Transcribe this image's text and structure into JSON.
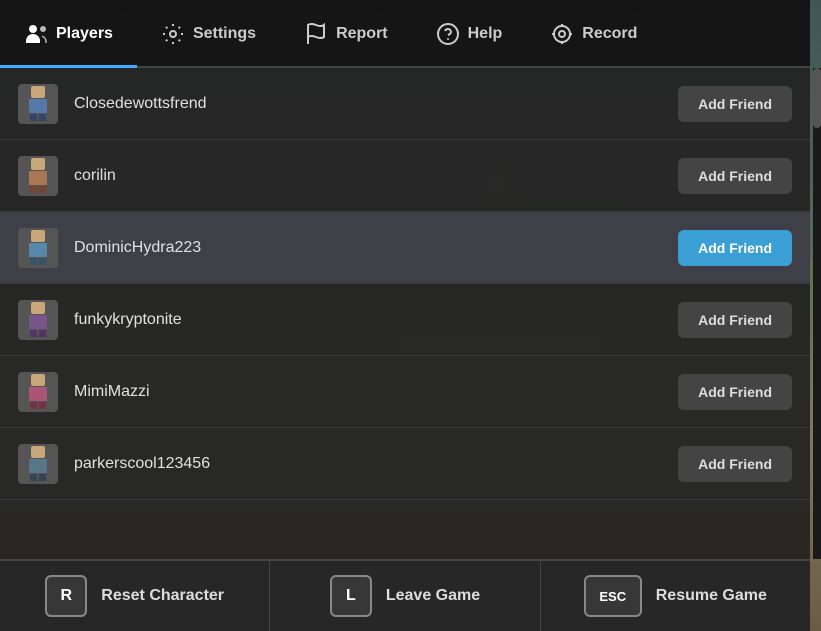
{
  "tabs": [
    {
      "id": "players",
      "label": "Players",
      "active": true,
      "icon": "players"
    },
    {
      "id": "settings",
      "label": "Settings",
      "active": false,
      "icon": "settings"
    },
    {
      "id": "report",
      "label": "Report",
      "active": false,
      "icon": "flag"
    },
    {
      "id": "help",
      "label": "Help",
      "active": false,
      "icon": "help"
    },
    {
      "id": "record",
      "label": "Record",
      "active": false,
      "icon": "record"
    }
  ],
  "players": [
    {
      "id": 1,
      "name": "Closedewottsfrend",
      "avatar_color": "#5577aa",
      "add_btn": "Add Friend",
      "highlighted": false
    },
    {
      "id": 2,
      "name": "corilin",
      "avatar_color": "#aa7755",
      "add_btn": "Add Friend",
      "highlighted": false
    },
    {
      "id": 3,
      "name": "DominicHydra223",
      "avatar_color": "#5588aa",
      "add_btn": "Add Friend",
      "highlighted": true
    },
    {
      "id": 4,
      "name": "funkykryptonite",
      "avatar_color": "#775588",
      "add_btn": "Add Friend",
      "highlighted": false
    },
    {
      "id": 5,
      "name": "MimiMazzi",
      "avatar_color": "#aa5577",
      "add_btn": "Add Friend",
      "highlighted": false
    },
    {
      "id": 6,
      "name": "parkerscool123456",
      "avatar_color": "#557788",
      "add_btn": "Add Friend",
      "highlighted": false
    }
  ],
  "actions": [
    {
      "id": "reset",
      "key": "R",
      "label": "Reset Character",
      "wide": false
    },
    {
      "id": "leave",
      "key": "L",
      "label": "Leave Game",
      "wide": false
    },
    {
      "id": "resume",
      "key": "ESC",
      "label": "Resume Game",
      "wide": true
    }
  ],
  "colors": {
    "active_tab": "#44aaff",
    "add_friend_highlighted": "#3a9fd4"
  }
}
